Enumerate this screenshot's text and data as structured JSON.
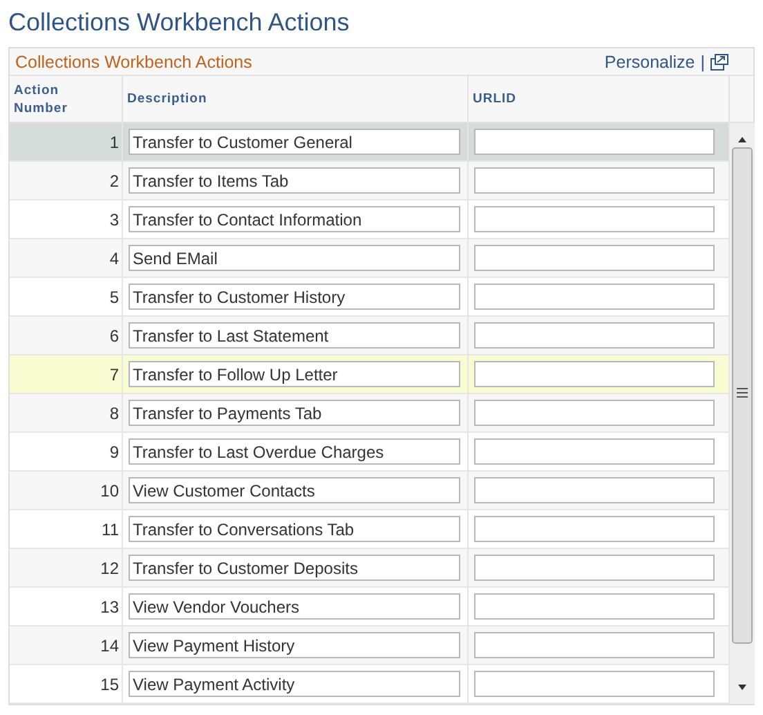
{
  "page_title": "Collections Workbench Actions",
  "grid": {
    "title": "Collections Workbench Actions",
    "personalize_link": "Personalize",
    "separator": "|",
    "columns": [
      "Action Number",
      "Description",
      "URLID"
    ],
    "rows": [
      {
        "number": "1",
        "description": "Transfer to Customer General",
        "urlid": "",
        "selected": true,
        "hovered": false
      },
      {
        "number": "2",
        "description": "Transfer to Items Tab",
        "urlid": "",
        "selected": false,
        "hovered": false
      },
      {
        "number": "3",
        "description": "Transfer to Contact Information",
        "urlid": "",
        "selected": false,
        "hovered": false
      },
      {
        "number": "4",
        "description": "Send EMail",
        "urlid": "",
        "selected": false,
        "hovered": false
      },
      {
        "number": "5",
        "description": "Transfer to Customer History",
        "urlid": "",
        "selected": false,
        "hovered": false
      },
      {
        "number": "6",
        "description": "Transfer to Last Statement",
        "urlid": "",
        "selected": false,
        "hovered": false
      },
      {
        "number": "7",
        "description": "Transfer to Follow Up Letter",
        "urlid": "",
        "selected": false,
        "hovered": true
      },
      {
        "number": "8",
        "description": "Transfer to Payments Tab",
        "urlid": "",
        "selected": false,
        "hovered": false
      },
      {
        "number": "9",
        "description": "Transfer to Last Overdue Charges",
        "urlid": "",
        "selected": false,
        "hovered": false
      },
      {
        "number": "10",
        "description": "View Customer Contacts",
        "urlid": "",
        "selected": false,
        "hovered": false
      },
      {
        "number": "11",
        "description": "Transfer to Conversations Tab",
        "urlid": "",
        "selected": false,
        "hovered": false
      },
      {
        "number": "12",
        "description": "Transfer to Customer Deposits",
        "urlid": "",
        "selected": false,
        "hovered": false
      },
      {
        "number": "13",
        "description": "View Vendor Vouchers",
        "urlid": "",
        "selected": false,
        "hovered": false
      },
      {
        "number": "14",
        "description": "View Payment History",
        "urlid": "",
        "selected": false,
        "hovered": false
      },
      {
        "number": "15",
        "description": "View Payment Activity",
        "urlid": "",
        "selected": false,
        "hovered": false
      }
    ]
  }
}
